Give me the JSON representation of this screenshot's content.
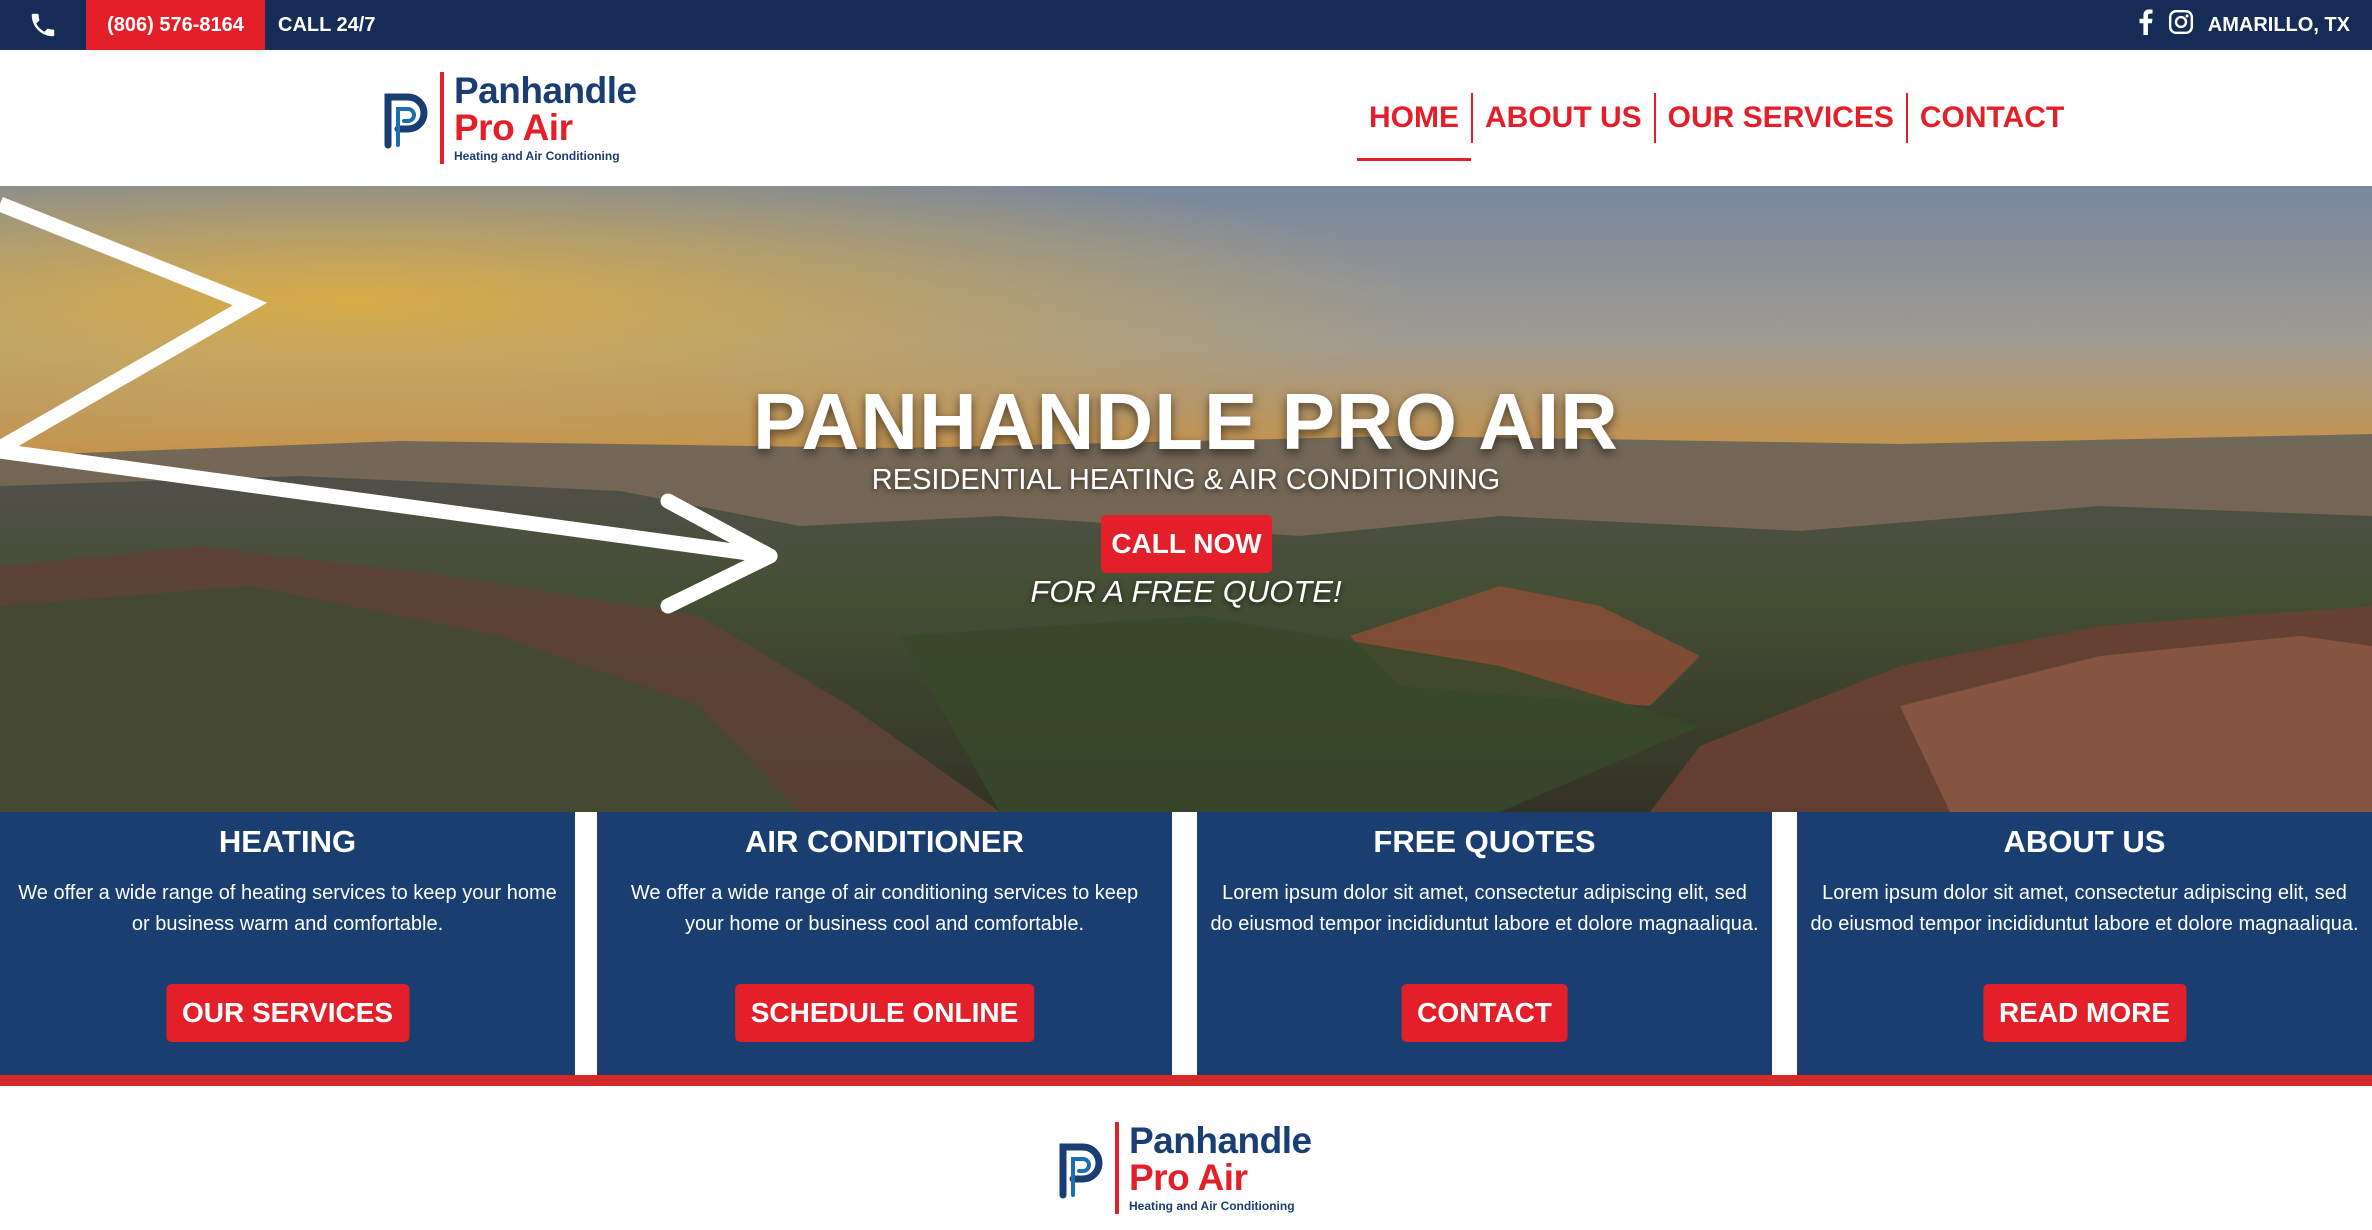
{
  "topbar": {
    "phone": "(806) 576-8164",
    "call_label": "CALL 24/7",
    "location": "AMARILLO, TX",
    "icons": [
      "phone-icon",
      "facebook-icon",
      "instagram-icon"
    ]
  },
  "logo": {
    "line1": "Panhandle",
    "line2": "Pro Air",
    "line3": "Heating and Air Conditioning"
  },
  "nav": {
    "items": [
      {
        "label": "HOME"
      },
      {
        "label": "ABOUT US"
      },
      {
        "label": "OUR SERVICES"
      },
      {
        "label": "CONTACT"
      }
    ]
  },
  "hero": {
    "title": "PANHANDLE PRO AIR",
    "subtitle": "RESIDENTIAL HEATING & AIR CONDITIONING",
    "cta": "CALL NOW",
    "tagline": "FOR A FREE QUOTE!"
  },
  "cards": [
    {
      "title": "HEATING",
      "text": "We offer a wide range of heating services to keep your home or business warm and comfortable.",
      "button": "OUR SERVICES"
    },
    {
      "title": "AIR CONDITIONER",
      "text": "We offer a wide range of air conditioning services to keep your home or business cool and comfortable.",
      "button": "SCHEDULE ONLINE"
    },
    {
      "title": "FREE QUOTES",
      "text": "Lorem ipsum dolor sit amet, consectetur adipiscing elit, sed do eiusmod tempor incididuntut labore et dolore magnaaliqua.",
      "button": "CONTACT"
    },
    {
      "title": "ABOUT US",
      "text": "Lorem ipsum dolor sit amet, consectetur adipiscing elit, sed do eiusmod tempor incididuntut labore et dolore magnaaliqua.",
      "button": "READ MORE"
    }
  ],
  "colors": {
    "navy": "#162b56",
    "card_blue": "#1a3e70",
    "red": "#e3202a"
  }
}
